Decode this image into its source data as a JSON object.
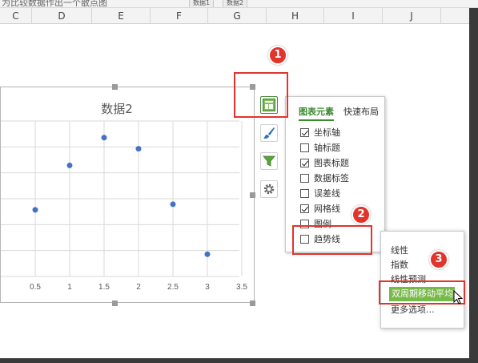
{
  "formula_bar": {
    "text": "为比较数据作出一个散点图"
  },
  "mini_tabs": [
    "数据1",
    "数据2"
  ],
  "column_letters": [
    "C",
    "D",
    "E",
    "F",
    "G",
    "H",
    "I",
    "J"
  ],
  "chart": {
    "title": "数据2"
  },
  "chart_data": {
    "type": "scatter",
    "title": "数据2",
    "x_tick_labels": [
      "0.5",
      "1",
      "1.5",
      "2",
      "2.5",
      "3",
      "3.5"
    ],
    "xlim": [
      0.5,
      3.5
    ],
    "ylim": [
      0,
      14
    ],
    "grid": true,
    "x": [
      0.5,
      1.0,
      1.5,
      2.0,
      2.5,
      3.0
    ],
    "y": [
      6.0,
      10.0,
      12.5,
      11.5,
      6.5,
      2.0
    ],
    "series_color": "#4472c4"
  },
  "tool_buttons": {
    "elements_icon": "chart-elements-icon",
    "style_icon": "paintbrush-icon",
    "filter_icon": "funnel-icon",
    "options_icon": "gear-icon"
  },
  "panel": {
    "tab_active": "图表元素",
    "tab_inactive": "快速布局",
    "items": [
      {
        "label": "坐标轴",
        "checked": true
      },
      {
        "label": "轴标题",
        "checked": false
      },
      {
        "label": "图表标题",
        "checked": true
      },
      {
        "label": "数据标签",
        "checked": false
      },
      {
        "label": "误差线",
        "checked": false
      },
      {
        "label": "网格线",
        "checked": true
      },
      {
        "label": "图例",
        "checked": false
      },
      {
        "label": "趋势线",
        "checked": false
      }
    ]
  },
  "submenu": {
    "items": [
      "线性",
      "指数",
      "线性预测",
      "双周期移动平均",
      "更多选项..."
    ],
    "highlighted": "双周期移动平均"
  },
  "step_badges": [
    "1",
    "2",
    "3"
  ],
  "colors": {
    "accent_green": "#3a8a2e",
    "highlight_green": "#78b94a",
    "annotation_red": "#e0342d",
    "point_blue": "#4472c4"
  }
}
